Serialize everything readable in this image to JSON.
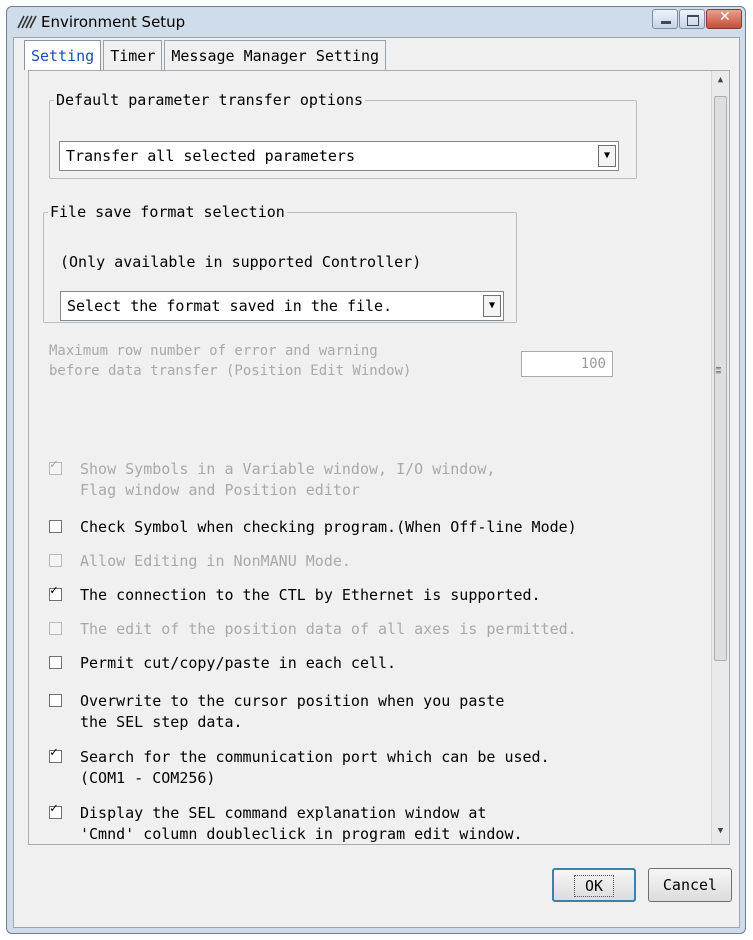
{
  "window": {
    "title": "Environment Setup"
  },
  "tabs": [
    "Setting",
    "Timer",
    "Message Manager Setting"
  ],
  "transfer_group": {
    "legend": "Default parameter transfer options",
    "selected": "Transfer all selected parameters"
  },
  "format_group": {
    "legend": "File save format selection",
    "note": "(Only available in supported Controller)",
    "selected": "Select the format saved in the file."
  },
  "max_row": {
    "label_line1": "Maximum row number of error and warning",
    "label_line2": "before data transfer (Position Edit Window)",
    "value": "100"
  },
  "checkboxes": [
    {
      "text": "Show Symbols in a Variable window, I/O window,\nFlag window and Position editor",
      "checked": true,
      "enabled": false
    },
    {
      "text": "Check Symbol when checking program.(When Off-line Mode)",
      "checked": false,
      "enabled": true
    },
    {
      "text": "Allow Editing in NonMANU Mode.",
      "checked": false,
      "enabled": false
    },
    {
      "text": "The connection to the CTL by Ethernet is supported.",
      "checked": true,
      "enabled": true
    },
    {
      "text": "The edit of the position data of all axes is permitted.",
      "checked": false,
      "enabled": false
    },
    {
      "text": "Permit cut/copy/paste in each cell.",
      "checked": false,
      "enabled": true
    },
    {
      "text": "Overwrite to the cursor position when you paste\nthe SEL step data.",
      "checked": false,
      "enabled": true
    },
    {
      "text": "Search for the communication port which can be used.\n(COM1 - COM256)",
      "checked": true,
      "enabled": true
    },
    {
      "text": "Display the SEL command explanation window at\n'Cmnd' column doubleclick in program edit window.",
      "checked": true,
      "enabled": true
    }
  ],
  "buttons": {
    "ok": "OK",
    "cancel": "Cancel"
  },
  "icons": {
    "app": "app-logo-icon",
    "minimize": "minimize-icon",
    "maximize": "maximize-icon",
    "close": "close-icon"
  }
}
